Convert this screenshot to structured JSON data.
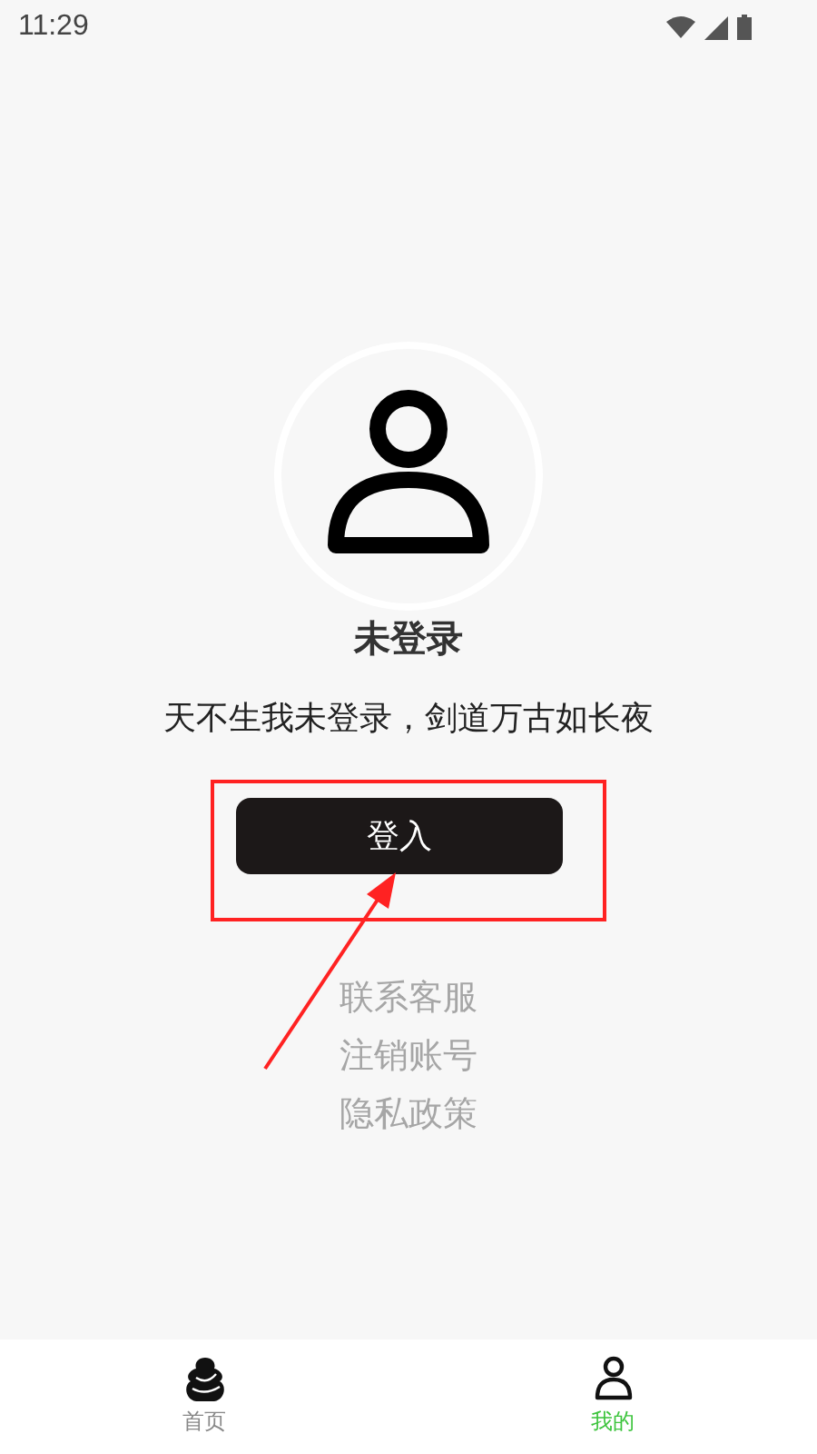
{
  "status_bar": {
    "time": "11:29"
  },
  "profile": {
    "name": "未登录",
    "motto": "天不生我未登录，剑道万古如长夜",
    "login_button": "登入"
  },
  "links": [
    "联系客服",
    "注销账号",
    "隐私政策"
  ],
  "tab_bar": [
    {
      "label": "首页",
      "kind": "home",
      "selected": false
    },
    {
      "label": "我的",
      "kind": "person",
      "selected": true
    }
  ]
}
